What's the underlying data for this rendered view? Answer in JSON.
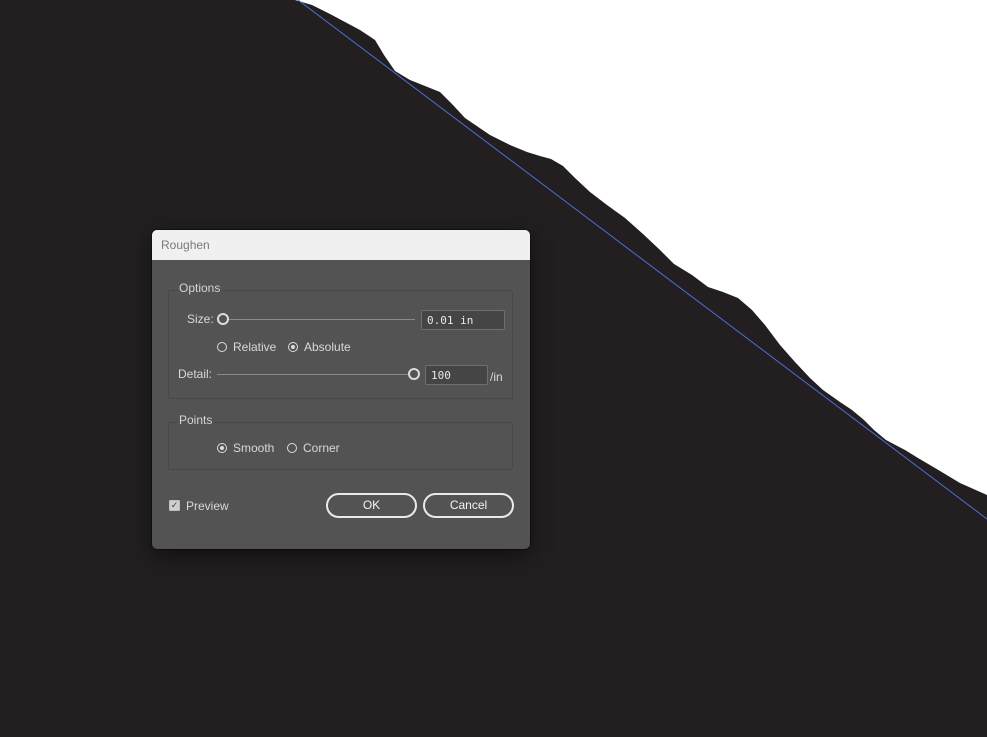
{
  "dialog": {
    "title": "Roughen",
    "options": {
      "group_label": "Options",
      "size_label": "Size:",
      "size_value": "0.01 in",
      "size_slider_fraction": 0,
      "relative_label": "Relative",
      "absolute_label": "Absolute",
      "selected_mode": "Absolute",
      "detail_label": "Detail:",
      "detail_value": "100",
      "detail_unit": "/in",
      "detail_slider_fraction": 1
    },
    "points": {
      "group_label": "Points",
      "smooth_label": "Smooth",
      "corner_label": "Corner",
      "selected": "Smooth"
    },
    "preview_label": "Preview",
    "preview_checked": true,
    "ok_label": "OK",
    "cancel_label": "Cancel"
  },
  "colors": {
    "canvas_background": "#231f20",
    "artboard_white": "#ffffff",
    "path_guide": "#4a6fd8",
    "dialog_body": "#535353",
    "dialog_titlebar": "#f0f0f0"
  }
}
